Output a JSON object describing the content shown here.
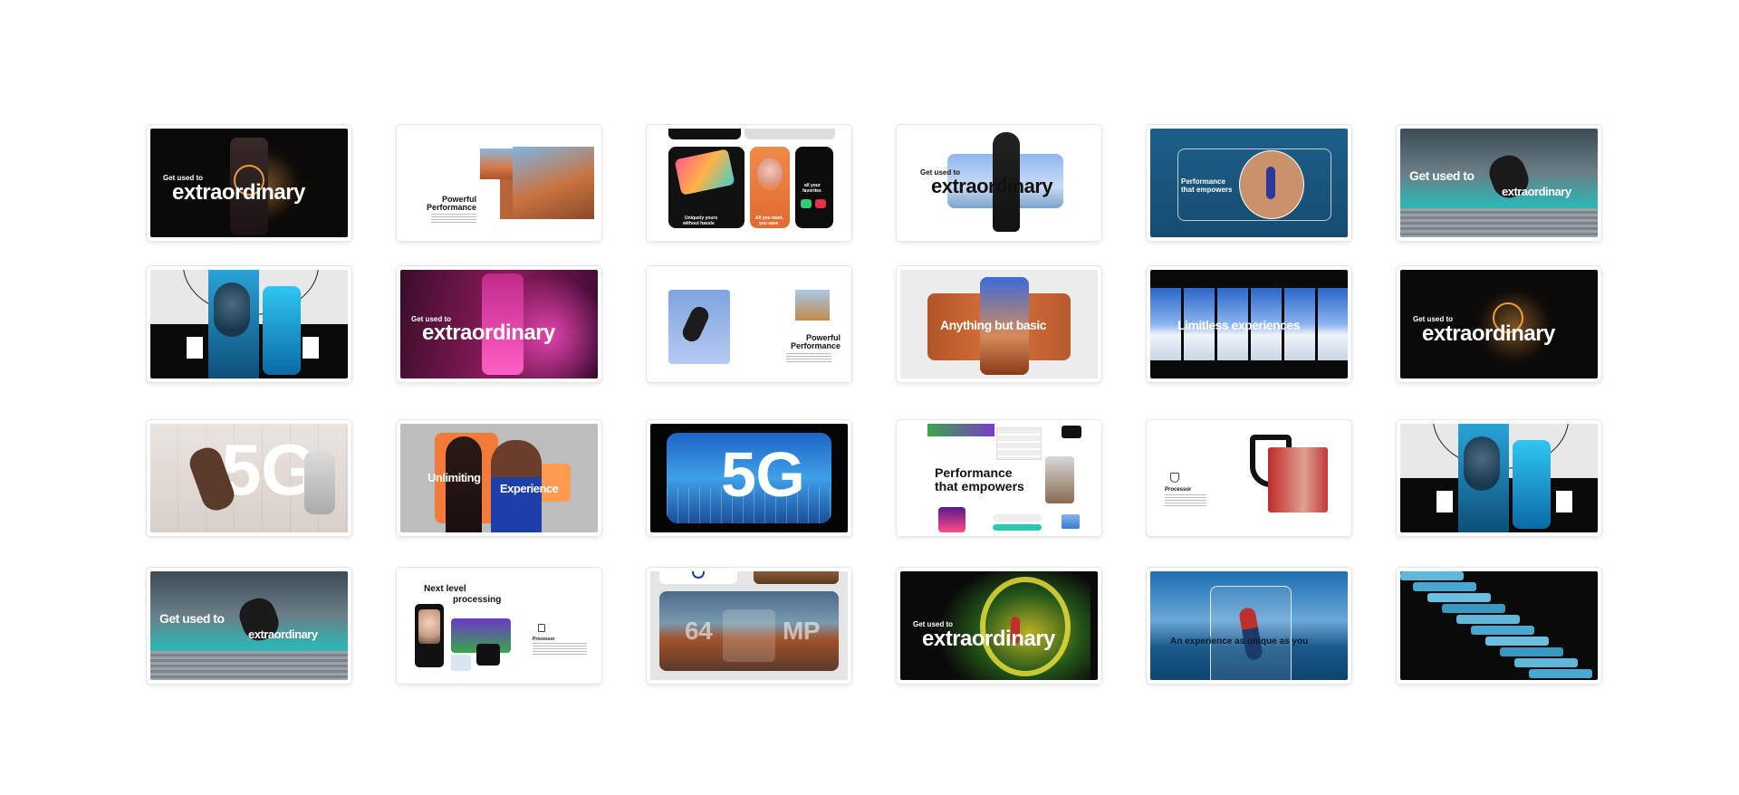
{
  "slides": [
    {
      "id": 1,
      "kicker": "Get used to",
      "headline": "extraordinary"
    },
    {
      "id": 2,
      "headline_line1": "Powerful",
      "headline_line2": "Performance"
    },
    {
      "id": 3,
      "caption_left_1": "Uniquely yours",
      "caption_left_2": "without hassle",
      "caption_mid_1": "All you want,",
      "caption_mid_2": "you save",
      "caption_right_1": "all your",
      "caption_right_2": "favorites"
    },
    {
      "id": 4,
      "kicker": "Get used to",
      "headline": "extraordinary"
    },
    {
      "id": 5,
      "headline_line1": "Performance",
      "headline_line2": "that empowers"
    },
    {
      "id": 6,
      "kicker": "Get used to",
      "headline": "extraordinary"
    },
    {
      "id": 7
    },
    {
      "id": 8,
      "kicker": "Get used to",
      "headline": "extraordinary"
    },
    {
      "id": 9,
      "headline_line1": "Powerful",
      "headline_line2": "Performance"
    },
    {
      "id": 10,
      "headline": "Anything but basic"
    },
    {
      "id": 11,
      "headline": "Limitless experiences"
    },
    {
      "id": 12,
      "kicker": "Get used to",
      "headline": "extraordinary"
    },
    {
      "id": 13,
      "big_mark": "5G"
    },
    {
      "id": 14,
      "word_left": "Unlimiting",
      "word_right": "Experience"
    },
    {
      "id": 15,
      "big_mark": "5G"
    },
    {
      "id": 16,
      "headline_line1": "Performance",
      "headline_line2": "that empowers"
    },
    {
      "id": 17,
      "label": "Processor"
    },
    {
      "id": 18
    },
    {
      "id": 19,
      "kicker": "Get used to",
      "headline": "extraordinary"
    },
    {
      "id": 20,
      "headline_line1": "Next level",
      "headline_line2": "processing",
      "label": "Processor"
    },
    {
      "id": 21,
      "mp_left": "64",
      "mp_right": "MP"
    },
    {
      "id": 22,
      "kicker": "Get used to",
      "headline": "extraordinary"
    },
    {
      "id": 23,
      "headline": "An experience as unique as you"
    },
    {
      "id": 24
    }
  ],
  "colors": {
    "accent_orange": "#ff8a2a",
    "accent_blue": "#1e8fe0",
    "dark": "#0b0b0d"
  }
}
